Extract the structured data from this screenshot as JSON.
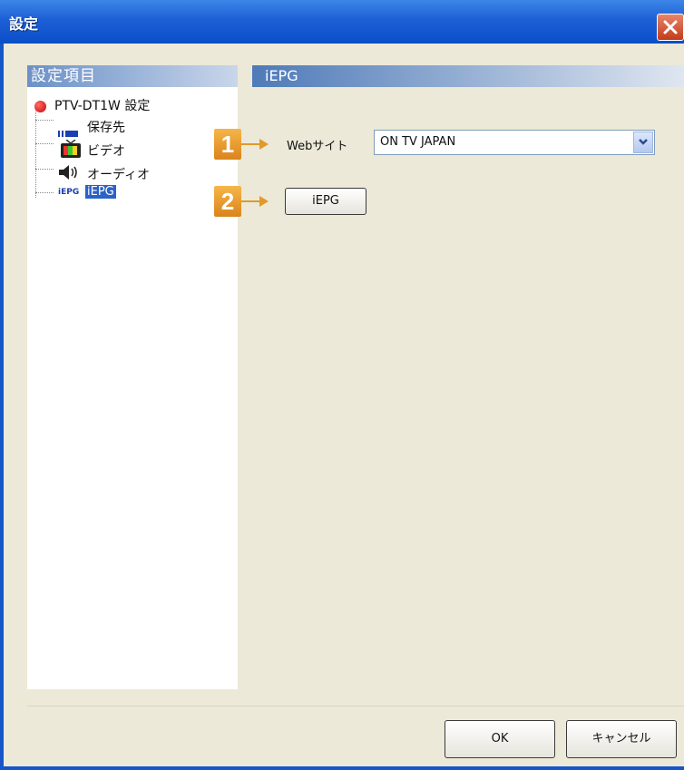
{
  "window": {
    "title": "設定"
  },
  "left_panel": {
    "header": "設定項目",
    "tree": {
      "root": "PTV-DT1W 設定",
      "items": [
        {
          "label": "保存先",
          "icon": "storage-icon"
        },
        {
          "label": "ビデオ",
          "icon": "tv-icon"
        },
        {
          "label": "オーディオ",
          "icon": "speaker-icon"
        },
        {
          "label": "iEPG",
          "icon": "iepg-icon",
          "icon_text": "iEPG",
          "selected": true
        }
      ]
    }
  },
  "right_panel": {
    "header": "iEPG",
    "website_label": "Webサイト",
    "website_value": "ON TV JAPAN",
    "iepg_button": "iEPG",
    "badges": [
      "1",
      "2"
    ]
  },
  "footer": {
    "ok": "OK",
    "cancel": "キャンセル"
  },
  "colors": {
    "titlebar": "#0a4fc8",
    "badge": "#e09a2a",
    "selection": "#2a62c8",
    "close": "#c23c1a"
  }
}
